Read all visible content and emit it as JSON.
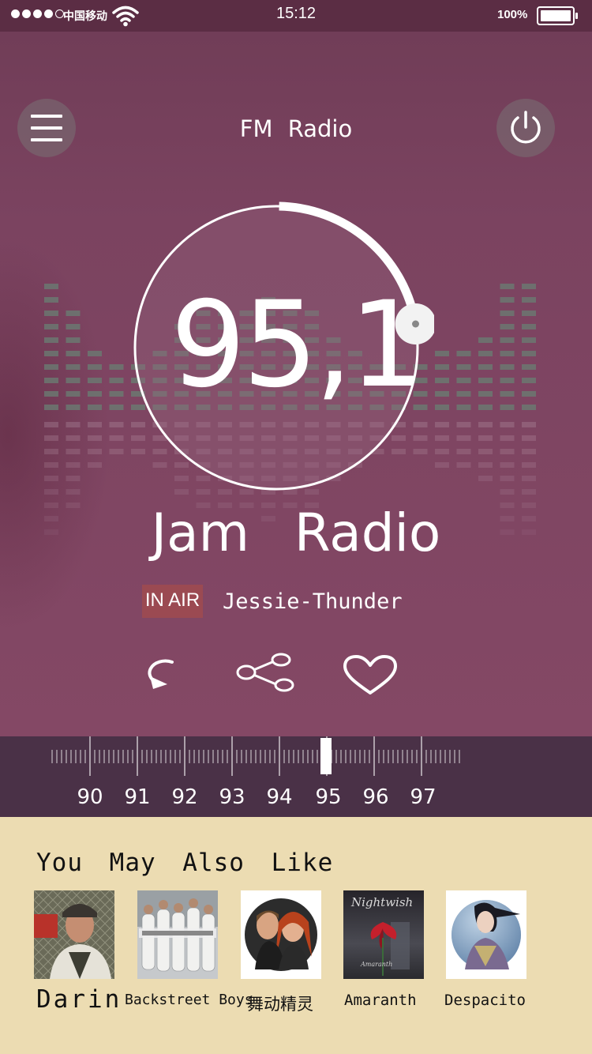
{
  "status_bar": {
    "carrier": "中国移动",
    "time": "15:12",
    "battery": "100%",
    "signal_dots_filled": 4,
    "signal_dots_total": 5,
    "battery_level": 1.0
  },
  "header": {
    "title": "FM  Radio",
    "menu_icon": "hamburger-menu-icon",
    "power_icon": "power-icon"
  },
  "player": {
    "frequency": "95,1",
    "dial_progress": 0.22,
    "station_name": "Jam  Radio",
    "badge": "IN AIR",
    "track": "Jessie-Thunder"
  },
  "actions": {
    "replay_icon": "replay-icon",
    "share_icon": "share-icon",
    "like_icon": "heart-icon"
  },
  "tuner": {
    "labels": [
      "90",
      "91",
      "92",
      "93",
      "94",
      "95",
      "96",
      "97"
    ],
    "current_value": 95
  },
  "recommendations": {
    "title": "You  May Also Like",
    "items": [
      {
        "label": "Darin"
      },
      {
        "label": "Backstreet Boys"
      },
      {
        "label": "舞动精灵"
      },
      {
        "label": "Amaranth"
      },
      {
        "label": "Despacito"
      }
    ]
  },
  "colors": {
    "background_top": "#7b4360",
    "tuner_bar": "#4a3147",
    "recommend_bg": "#ecdcb2",
    "badge": "#9b4a52"
  }
}
